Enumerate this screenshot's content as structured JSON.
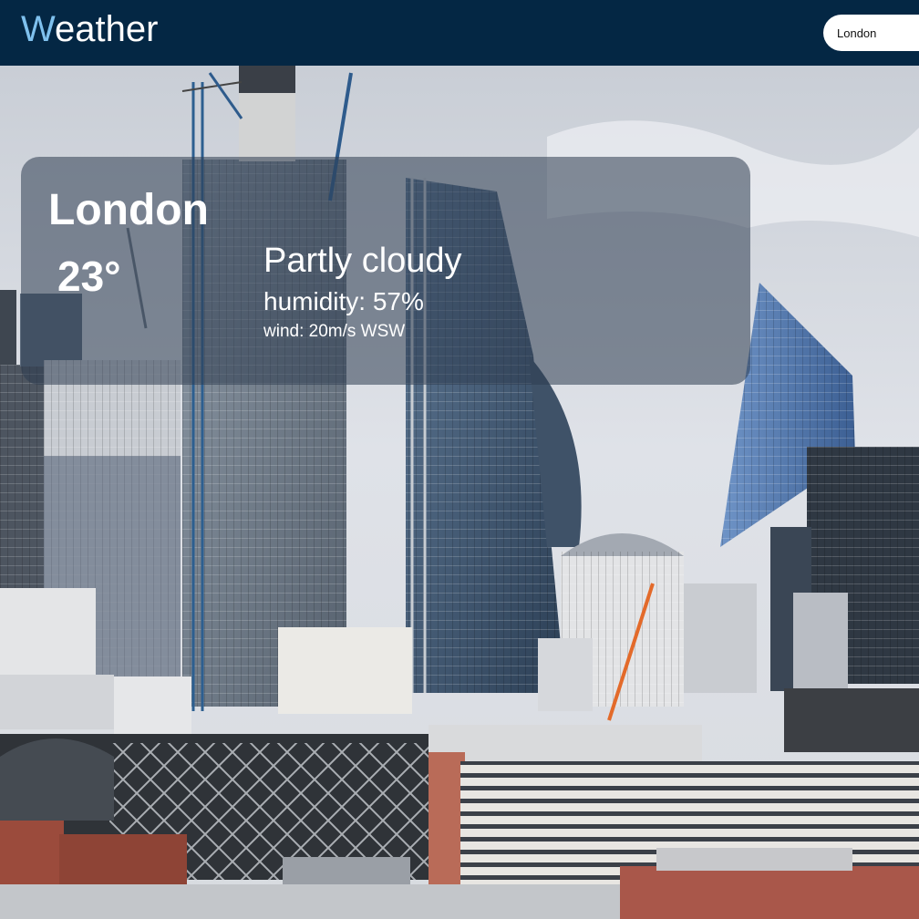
{
  "header": {
    "logo_initial": "W",
    "logo_rest": "eather",
    "search_value": "London"
  },
  "weather": {
    "city": "London",
    "temperature": "23°",
    "condition": "Partly cloudy",
    "humidity": "humidity: 57%",
    "wind": "wind: 20m/s WSW"
  },
  "background_image": "london-skyline-photo",
  "colors": {
    "header_bg": "#042744",
    "logo_accent": "#7fc1ee",
    "card_bg": "rgba(45, 60, 80, 0.55)"
  }
}
